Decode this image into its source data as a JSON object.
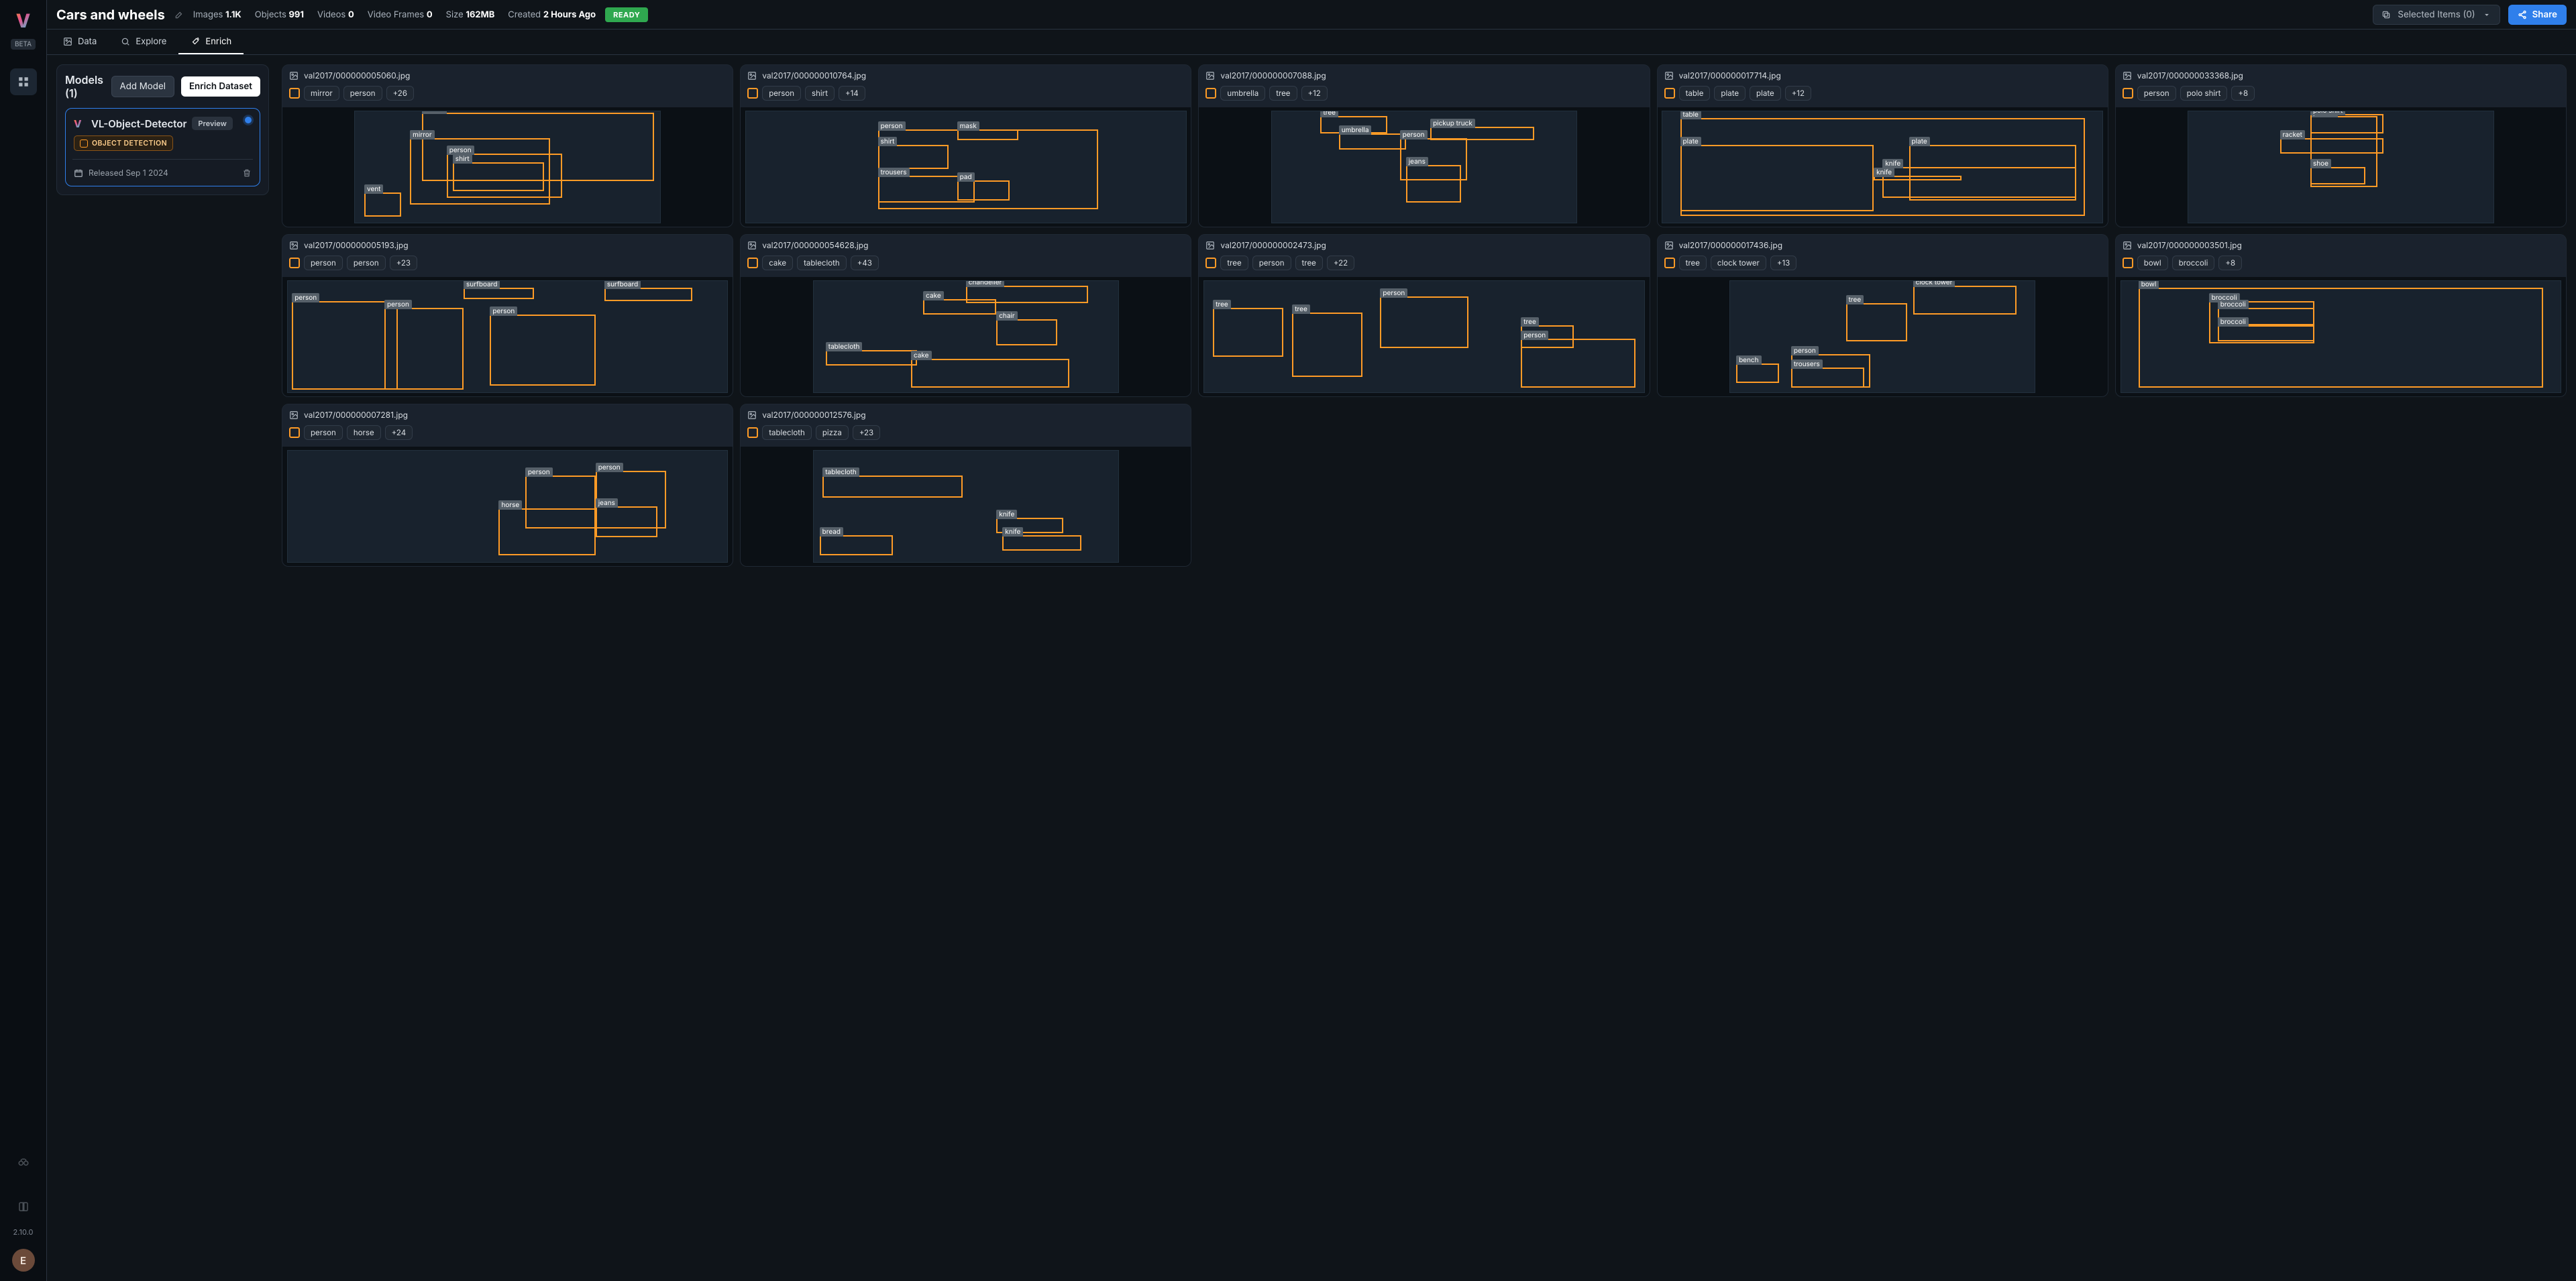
{
  "leftrail": {
    "logo": "V",
    "beta": "BETA",
    "version": "2.10.0",
    "avatar": "E"
  },
  "header": {
    "title": "Cars and wheels",
    "meta": [
      {
        "label": "Images",
        "value": "1.1K"
      },
      {
        "label": "Objects",
        "value": "991"
      },
      {
        "label": "Videos",
        "value": "0"
      },
      {
        "label": "Video Frames",
        "value": "0"
      },
      {
        "label": "Size",
        "value": "162MB"
      },
      {
        "label": "Created",
        "value": "2 Hours Ago"
      }
    ],
    "status": "READY",
    "selected": "Selected Items (0)",
    "share": "Share"
  },
  "tabs": {
    "data": "Data",
    "explore": "Explore",
    "enrich": "Enrich"
  },
  "side": {
    "heading": "Models (1)",
    "add": "Add Model",
    "enrich": "Enrich Dataset",
    "model": {
      "name": "VL-Object-Detector",
      "preview": "Preview",
      "chip": "OBJECT DETECTION",
      "released": "Released Sep 1 2024"
    }
  },
  "cards": [
    {
      "file": "val2017/000000005060.jpg",
      "tags": [
        "mirror",
        "person"
      ],
      "more": "+26",
      "thumb": "tall",
      "boxes": [
        {
          "l": 22,
          "t": 1,
          "w": 76,
          "h": 62,
          "lbl": "mirror"
        },
        {
          "l": 18,
          "t": 24,
          "w": 46,
          "h": 60,
          "lbl": "mirror"
        },
        {
          "l": 30,
          "t": 38,
          "w": 38,
          "h": 40,
          "lbl": "person"
        },
        {
          "l": 32,
          "t": 46,
          "w": 30,
          "h": 26,
          "lbl": "shirt"
        },
        {
          "l": 3,
          "t": 73,
          "w": 12,
          "h": 22,
          "lbl": "vent"
        }
      ]
    },
    {
      "file": "val2017/000000010764.jpg",
      "tags": [
        "person",
        "shirt"
      ],
      "more": "+14",
      "thumb": "wide",
      "boxes": [
        {
          "l": 30,
          "t": 16,
          "w": 50,
          "h": 72,
          "lbl": "person"
        },
        {
          "l": 48,
          "t": 16,
          "w": 14,
          "h": 10,
          "lbl": "mask"
        },
        {
          "l": 30,
          "t": 30,
          "w": 16,
          "h": 22,
          "lbl": "shirt"
        },
        {
          "l": 30,
          "t": 58,
          "w": 22,
          "h": 24,
          "lbl": "trousers"
        },
        {
          "l": 48,
          "t": 62,
          "w": 12,
          "h": 18,
          "lbl": "pad"
        }
      ]
    },
    {
      "file": "val2017/000000007088.jpg",
      "tags": [
        "umbrella",
        "tree"
      ],
      "more": "+12",
      "thumb": "tall",
      "boxes": [
        {
          "l": 16,
          "t": 4,
          "w": 22,
          "h": 16,
          "lbl": "tree"
        },
        {
          "l": 22,
          "t": 20,
          "w": 22,
          "h": 14,
          "lbl": "umbrella"
        },
        {
          "l": 52,
          "t": 14,
          "w": 34,
          "h": 12,
          "lbl": "pickup truck"
        },
        {
          "l": 42,
          "t": 24,
          "w": 22,
          "h": 38,
          "lbl": "person"
        },
        {
          "l": 44,
          "t": 48,
          "w": 18,
          "h": 34,
          "lbl": "jeans"
        }
      ]
    },
    {
      "file": "val2017/000000017714.jpg",
      "tags": [
        "table",
        "plate",
        "plate"
      ],
      "more": "+12",
      "thumb": "full",
      "boxes": [
        {
          "l": 4,
          "t": 6,
          "w": 92,
          "h": 88,
          "lbl": "table"
        },
        {
          "l": 4,
          "t": 30,
          "w": 44,
          "h": 60,
          "lbl": "plate"
        },
        {
          "l": 56,
          "t": 30,
          "w": 38,
          "h": 50,
          "lbl": "plate"
        },
        {
          "l": 50,
          "t": 50,
          "w": 44,
          "h": 28,
          "lbl": "knife"
        },
        {
          "l": 48,
          "t": 58,
          "w": 20,
          "h": 4,
          "lbl": "knife"
        }
      ]
    },
    {
      "file": "val2017/000000033368.jpg",
      "tags": [
        "person",
        "polo shirt"
      ],
      "more": "+8",
      "thumb": "tall",
      "boxes": [
        {
          "l": 40,
          "t": 4,
          "w": 22,
          "h": 64,
          "lbl": "person"
        },
        {
          "l": 40,
          "t": 2,
          "w": 24,
          "h": 18,
          "lbl": "polo shirt"
        },
        {
          "l": 30,
          "t": 24,
          "w": 34,
          "h": 14,
          "lbl": "racket"
        },
        {
          "l": 40,
          "t": 50,
          "w": 18,
          "h": 16,
          "lbl": "shoe"
        }
      ]
    },
    {
      "file": "val2017/000000005193.jpg",
      "tags": [
        "person",
        "person"
      ],
      "more": "+23",
      "thumb": "full",
      "boxes": [
        {
          "l": 1,
          "t": 18,
          "w": 24,
          "h": 80,
          "lbl": "person"
        },
        {
          "l": 22,
          "t": 24,
          "w": 18,
          "h": 74,
          "lbl": "person"
        },
        {
          "l": 40,
          "t": 6,
          "w": 16,
          "h": 10,
          "lbl": "surfboard"
        },
        {
          "l": 72,
          "t": 6,
          "w": 20,
          "h": 12,
          "lbl": "surfboard"
        },
        {
          "l": 46,
          "t": 30,
          "w": 24,
          "h": 64,
          "lbl": "person"
        }
      ]
    },
    {
      "file": "val2017/000000054628.jpg",
      "tags": [
        "cake",
        "tablecloth"
      ],
      "more": "+43",
      "thumb": "tall",
      "boxes": [
        {
          "l": 50,
          "t": 4,
          "w": 40,
          "h": 16,
          "lbl": "chandelier"
        },
        {
          "l": 36,
          "t": 16,
          "w": 24,
          "h": 14,
          "lbl": "cake"
        },
        {
          "l": 60,
          "t": 34,
          "w": 20,
          "h": 24,
          "lbl": "chair"
        },
        {
          "l": 4,
          "t": 62,
          "w": 30,
          "h": 14,
          "lbl": "tablecloth"
        },
        {
          "l": 32,
          "t": 70,
          "w": 52,
          "h": 26,
          "lbl": "cake"
        }
      ]
    },
    {
      "file": "val2017/000000002473.jpg",
      "tags": [
        "tree",
        "person",
        "tree"
      ],
      "more": "+22",
      "thumb": "full",
      "boxes": [
        {
          "l": 2,
          "t": 24,
          "w": 16,
          "h": 44,
          "lbl": "tree"
        },
        {
          "l": 20,
          "t": 28,
          "w": 16,
          "h": 58,
          "lbl": "tree"
        },
        {
          "l": 40,
          "t": 14,
          "w": 20,
          "h": 46,
          "lbl": "person"
        },
        {
          "l": 72,
          "t": 40,
          "w": 12,
          "h": 20,
          "lbl": "tree"
        },
        {
          "l": 72,
          "t": 52,
          "w": 26,
          "h": 44,
          "lbl": "person"
        }
      ]
    },
    {
      "file": "val2017/000000017436.jpg",
      "tags": [
        "tree",
        "clock tower"
      ],
      "more": "+13",
      "thumb": "tall",
      "boxes": [
        {
          "l": 60,
          "t": 4,
          "w": 34,
          "h": 26,
          "lbl": "clock tower"
        },
        {
          "l": 38,
          "t": 20,
          "w": 20,
          "h": 34,
          "lbl": "tree"
        },
        {
          "l": 2,
          "t": 74,
          "w": 14,
          "h": 18,
          "lbl": "bench"
        },
        {
          "l": 20,
          "t": 66,
          "w": 26,
          "h": 30,
          "lbl": "person"
        },
        {
          "l": 20,
          "t": 78,
          "w": 24,
          "h": 18,
          "lbl": "trousers"
        }
      ]
    },
    {
      "file": "val2017/000000003501.jpg",
      "tags": [
        "bowl",
        "broccoli"
      ],
      "more": "+8",
      "thumb": "full",
      "boxes": [
        {
          "l": 4,
          "t": 6,
          "w": 92,
          "h": 90,
          "lbl": "bowl"
        },
        {
          "l": 20,
          "t": 18,
          "w": 24,
          "h": 38,
          "lbl": "broccoli"
        },
        {
          "l": 22,
          "t": 24,
          "w": 22,
          "h": 16,
          "lbl": "broccoli"
        },
        {
          "l": 22,
          "t": 40,
          "w": 22,
          "h": 14,
          "lbl": "broccoli"
        }
      ]
    },
    {
      "file": "val2017/000000007281.jpg",
      "tags": [
        "person",
        "horse"
      ],
      "more": "+24",
      "thumb": "full",
      "boxes": [
        {
          "l": 70,
          "t": 18,
          "w": 16,
          "h": 52,
          "lbl": "person"
        },
        {
          "l": 54,
          "t": 22,
          "w": 16,
          "h": 48,
          "lbl": "person"
        },
        {
          "l": 48,
          "t": 52,
          "w": 22,
          "h": 42,
          "lbl": "horse"
        },
        {
          "l": 70,
          "t": 50,
          "w": 14,
          "h": 28,
          "lbl": "jeans"
        }
      ]
    },
    {
      "file": "val2017/000000012576.jpg",
      "tags": [
        "tablecloth",
        "pizza"
      ],
      "more": "+23",
      "thumb": "tall",
      "boxes": [
        {
          "l": 3,
          "t": 22,
          "w": 46,
          "h": 20,
          "lbl": "tablecloth"
        },
        {
          "l": 2,
          "t": 76,
          "w": 24,
          "h": 18,
          "lbl": "bread"
        },
        {
          "l": 60,
          "t": 60,
          "w": 22,
          "h": 14,
          "lbl": "knife"
        },
        {
          "l": 62,
          "t": 76,
          "w": 26,
          "h": 14,
          "lbl": "knife"
        }
      ]
    }
  ]
}
